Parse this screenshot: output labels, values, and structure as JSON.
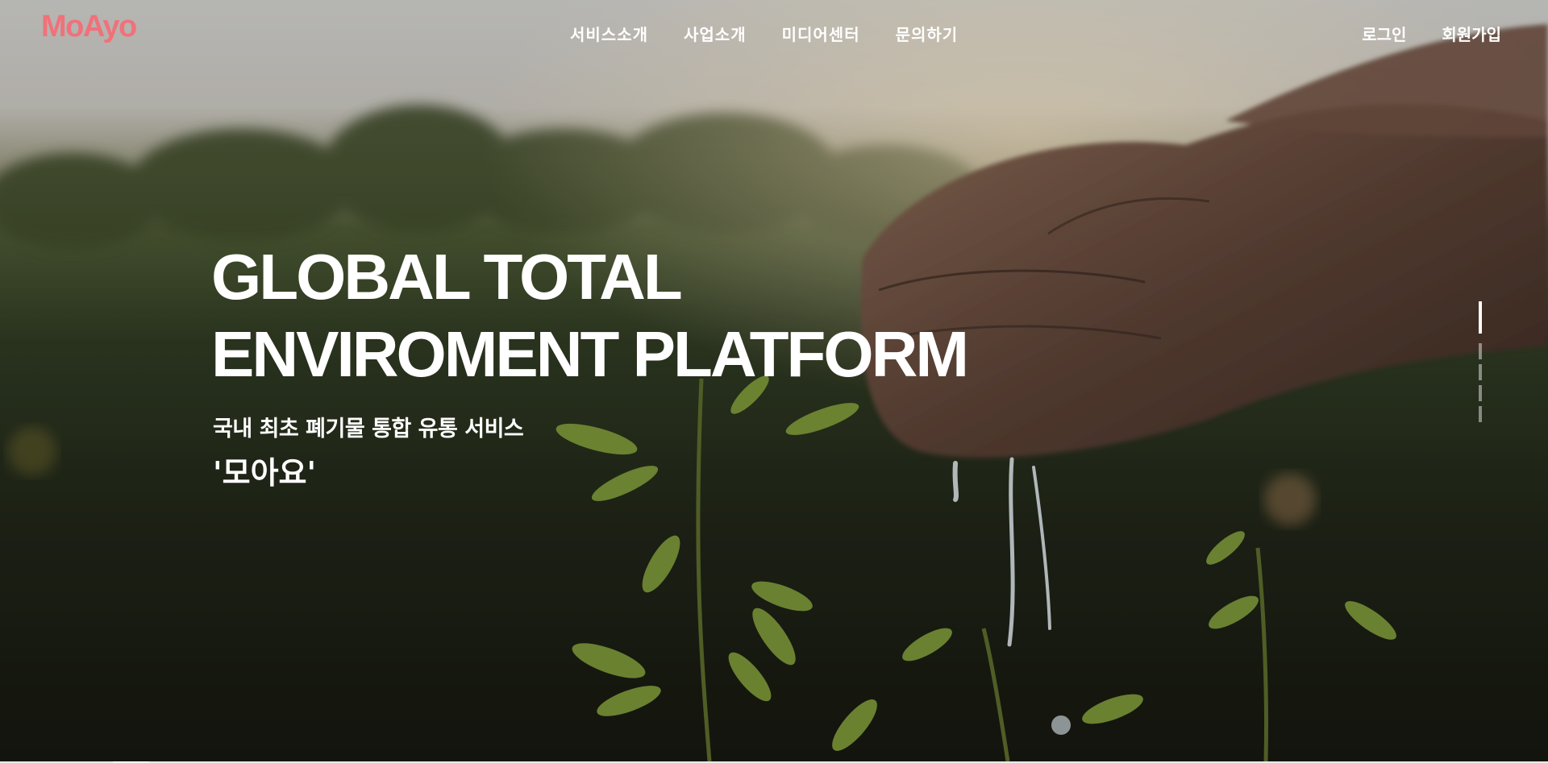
{
  "header": {
    "logo": "MoAyo",
    "nav": [
      {
        "label": "서비스소개"
      },
      {
        "label": "사업소개"
      },
      {
        "label": "미디어센터"
      },
      {
        "label": "문의하기"
      }
    ],
    "auth": {
      "login": "로그인",
      "signup": "회원가입"
    }
  },
  "hero": {
    "title_line1": "GLOBAL TOTAL",
    "title_line2": "ENVIROMENT PLATFORM",
    "subtitle": "국내 최초 폐기물 통합 유통 서비스",
    "brand": "'모아요'"
  },
  "slider": {
    "slide_count": 5,
    "active_index": 0
  },
  "colors": {
    "logo": "#f0717a",
    "text": "#ffffff"
  }
}
